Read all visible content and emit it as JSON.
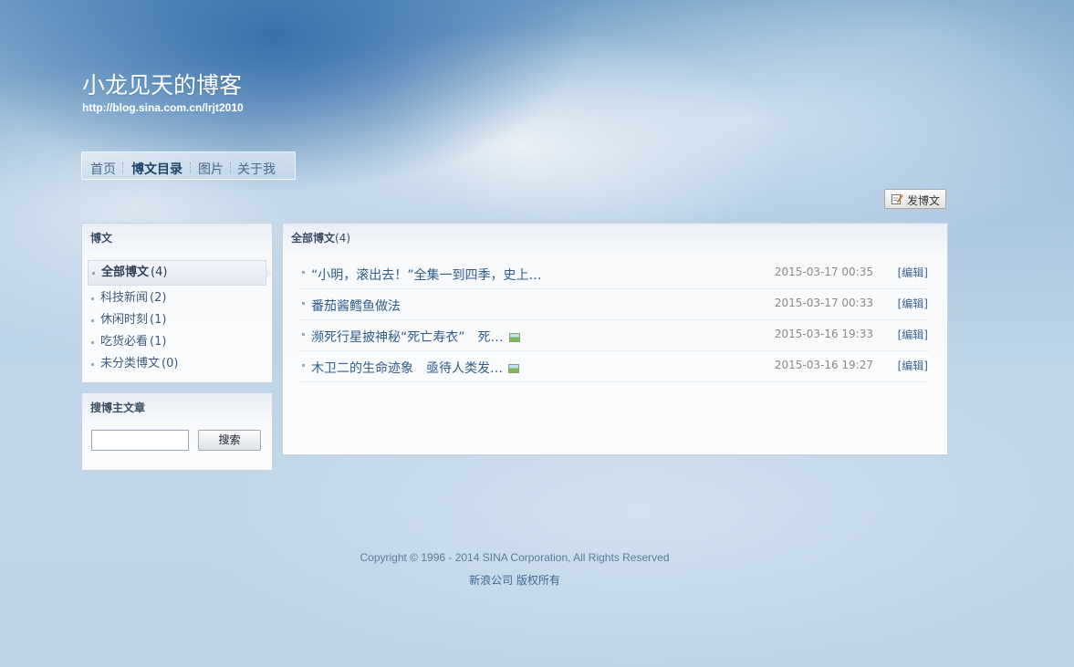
{
  "header": {
    "title": "小龙见天的博客",
    "url": "http://blog.sina.com.cn/lrjt2010"
  },
  "nav": {
    "items": [
      {
        "label": "首页",
        "active": false
      },
      {
        "label": "博文目录",
        "active": true
      },
      {
        "label": "图片",
        "active": false
      },
      {
        "label": "关于我",
        "active": false
      }
    ]
  },
  "toolbar": {
    "post_label": "发博文",
    "post_icon": "edit-icon"
  },
  "sidebar": {
    "categories_title": "博文",
    "categories": [
      {
        "label": "全部博文",
        "count": "(4)",
        "active": true
      },
      {
        "label": "科技新闻",
        "count": "(2)",
        "active": false
      },
      {
        "label": "休闲时刻",
        "count": "(1)",
        "active": false
      },
      {
        "label": "吃货必看",
        "count": "(1)",
        "active": false
      },
      {
        "label": "未分类博文",
        "count": "(0)",
        "active": false
      }
    ],
    "search_title": "搜博主文章",
    "search_value": "",
    "search_button": "搜索"
  },
  "main": {
    "title": "全部博文",
    "count": "(4)",
    "articles": [
      {
        "title": "“小明，滚出去！”全集一到四季，史上…",
        "date": "2015-03-17 00:35",
        "edit": "[编辑]",
        "has_image": false
      },
      {
        "title": "番茄酱鳕鱼做法",
        "date": "2015-03-17 00:33",
        "edit": "[编辑]",
        "has_image": false
      },
      {
        "title": "濒死行星披神秘“死亡寿衣”　死…",
        "date": "2015-03-16 19:33",
        "edit": "[编辑]",
        "has_image": true
      },
      {
        "title": "木卫二的生命迹象　亟待人类发…",
        "date": "2015-03-16 19:27",
        "edit": "[编辑]",
        "has_image": true
      }
    ]
  },
  "footer": {
    "copyright": "Copyright © 1996 - 2014 SINA Corporation, All Rights Reserved",
    "company": "新浪公司 版权所有"
  }
}
